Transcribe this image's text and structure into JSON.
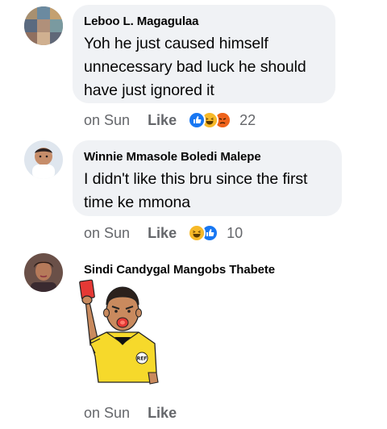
{
  "comments": [
    {
      "author": "Leboo L. Magagulaa",
      "text_lines": [
        "Yoh he just caused himself",
        "unnecessary bad luck he should",
        "have just ignored it"
      ],
      "time": "on Sun",
      "like_label": "Like",
      "reactions": [
        "like-icon",
        "haha-icon",
        "angry-icon"
      ],
      "reaction_count": "22"
    },
    {
      "author": "Winnie Mmasole Boledi Malepe",
      "text_lines": [
        "I didn't like this bru since the first",
        "time ke mmona"
      ],
      "time": "on Sun",
      "like_label": "Like",
      "reactions": [
        "haha-icon",
        "like-icon"
      ],
      "reaction_count": "10"
    },
    {
      "author": "Sindi Candygal Mangobs Thabete",
      "sticker": "referee-red-card-sticker",
      "sticker_badge": "REF",
      "time": "on Sun",
      "like_label": "Like"
    }
  ],
  "colors": {
    "bubble": "#f0f2f5",
    "meta_text": "#65676b",
    "like_blue": "#1877f2",
    "haha_yellow": "#f7b928",
    "angry_red": "#e9710f"
  }
}
